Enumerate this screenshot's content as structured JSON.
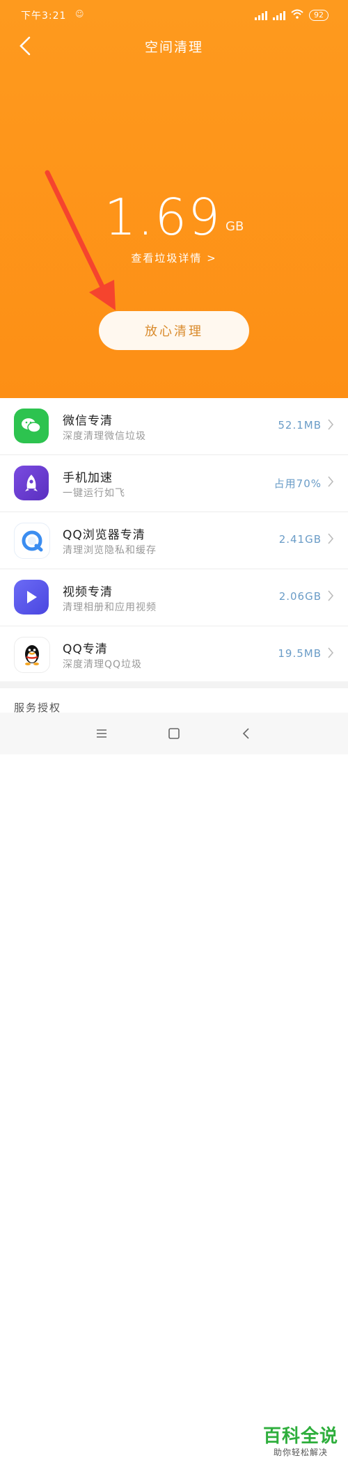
{
  "status": {
    "time": "下午3:21",
    "battery": "92"
  },
  "header": {
    "title": "空间清理"
  },
  "summary": {
    "size": "1.69",
    "unit": "GB",
    "detail_link": "查看垃圾详情 >"
  },
  "actions": {
    "clean_button": "放心清理"
  },
  "items": [
    {
      "title": "微信专清",
      "subtitle": "深度清理微信垃圾",
      "value": "52.1MB",
      "icon": "wechat-icon",
      "color": "#2dc34f"
    },
    {
      "title": "手机加速",
      "subtitle": "一键运行如飞",
      "value": "占用70%",
      "icon": "rocket-icon",
      "color": "#6a3fd0"
    },
    {
      "title": "QQ浏览器专清",
      "subtitle": "清理浏览隐私和缓存",
      "value": "2.41GB",
      "icon": "qq-browser-icon",
      "color": "#3b8df0"
    },
    {
      "title": "视频专清",
      "subtitle": "清理相册和应用视频",
      "value": "2.06GB",
      "icon": "video-play-icon",
      "color": "#5b5bf0"
    },
    {
      "title": "QQ专清",
      "subtitle": "深度清理QQ垃圾",
      "value": "19.5MB",
      "icon": "qq-penguin-icon",
      "color": "#111111"
    }
  ],
  "footer": {
    "service_label": "服务授权"
  },
  "watermark": {
    "main": "百科全说",
    "sub": "助你轻松解决"
  },
  "colors": {
    "hero": "#fe9a1e",
    "arrow": "#f5442e",
    "value_text": "#6a9cc7"
  }
}
